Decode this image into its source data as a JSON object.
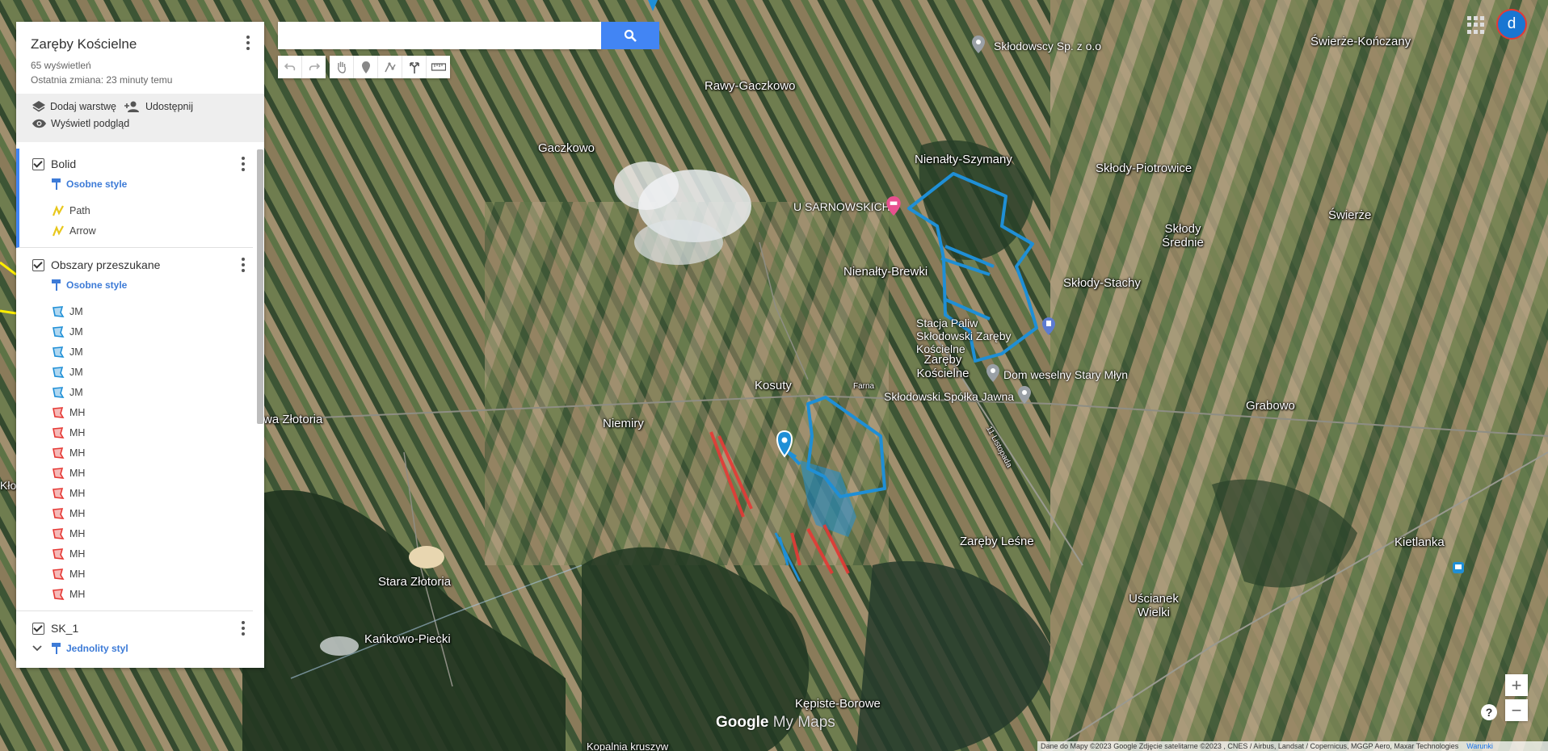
{
  "map_title": "Zaręby Kościelne",
  "views": "65 wyświetleń",
  "last_change": "Ostatnia zmiana: 23 minuty temu",
  "actions": {
    "add_layer": "Dodaj warstwę",
    "share": "Udostępnij",
    "preview": "Wyświetl podgląd"
  },
  "layers": [
    {
      "name": "Bolid",
      "style": "Osobne style",
      "items": [
        {
          "label": "Path",
          "icon": "path-icon"
        },
        {
          "label": "Arrow",
          "icon": "path-icon"
        }
      ]
    },
    {
      "name": "Obszary przeszukane",
      "style": "Osobne style",
      "items": [
        {
          "label": "JM",
          "icon": "polygon-blue-icon"
        },
        {
          "label": "JM",
          "icon": "polygon-blue-icon"
        },
        {
          "label": "JM",
          "icon": "polygon-blue-icon"
        },
        {
          "label": "JM",
          "icon": "polygon-blue-icon"
        },
        {
          "label": "JM",
          "icon": "polygon-blue-icon"
        },
        {
          "label": "MH",
          "icon": "polygon-red-icon"
        },
        {
          "label": "MH",
          "icon": "polygon-red-icon"
        },
        {
          "label": "MH",
          "icon": "polygon-red-icon"
        },
        {
          "label": "MH",
          "icon": "polygon-red-icon"
        },
        {
          "label": "MH",
          "icon": "polygon-red-icon"
        },
        {
          "label": "MH",
          "icon": "polygon-red-icon"
        },
        {
          "label": "MH",
          "icon": "polygon-red-icon"
        },
        {
          "label": "MH",
          "icon": "polygon-red-icon"
        },
        {
          "label": "MH",
          "icon": "polygon-red-icon"
        },
        {
          "label": "MH",
          "icon": "polygon-red-icon"
        }
      ]
    },
    {
      "name": "SK_1",
      "style": "Jednolity styl",
      "items": []
    }
  ],
  "search": {
    "placeholder": ""
  },
  "avatar_letter": "d",
  "places": [
    "Rawy-Gaczkowo",
    "Gaczkowo",
    "Nienałty-Szymany",
    "Skłody-Piotrowice",
    "Świerże-Kończany",
    "Skłody Średnie",
    "Świerże",
    "Nienałty-Brewki",
    "Skłody-Stachy",
    "Zaręby Kościelne",
    "Kosuty",
    "Niemiry",
    "wa Złotoria",
    "Grabowo",
    "Zaręby Leśne",
    "Kietlanka",
    "Stara Złotoria",
    "Kańkowo-Piecki",
    "Uścianek Wielki",
    "Kępiste-Borowe",
    "Kopalnia kruszyw",
    "Farna",
    "11 Listopada",
    "Kło"
  ],
  "pois": [
    "Skłodowscy Sp. z o.o",
    "U SARNOWSKICH",
    "Stacja Paliw Skłodowski Zaręby Kościelne",
    "Dom weselny Stary Młyn",
    "Skłodowski Spółka Jawna"
  ],
  "logo": {
    "google": "Google",
    "mymaps": "My Maps"
  },
  "attribution": "Dane do Mapy ©2023 Google Zdjęcie satelitarne ©2023 , CNES / Airbus, Landsat / Copernicus, MGGP Aero, Maxar Technologies",
  "terms": "Warunki",
  "zoom": {
    "in": "+",
    "out": "−"
  },
  "help": "?",
  "colors": {
    "accent": "#4285f4",
    "route": "#1f8fd6",
    "searched_red": "#e53935"
  }
}
